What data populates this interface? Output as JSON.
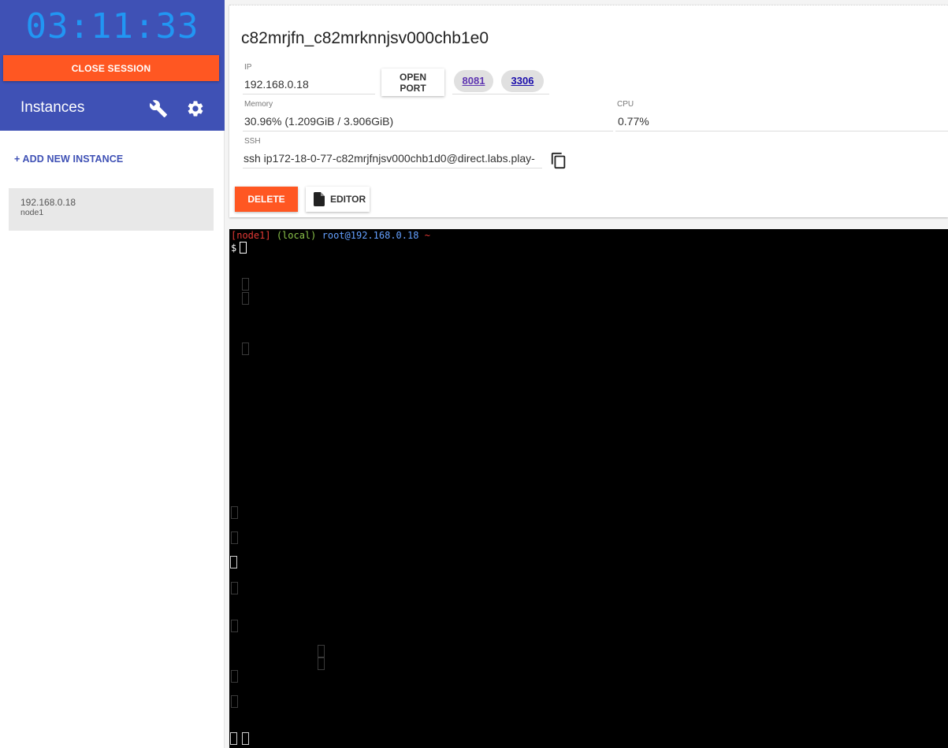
{
  "session": {
    "timer": "03:11:33",
    "close_label": "CLOSE SESSION"
  },
  "sidebar": {
    "title": "Instances",
    "add_instance_label": "+ ADD NEW INSTANCE",
    "instances": [
      {
        "ip": "192.168.0.18",
        "name": "node1"
      }
    ]
  },
  "instance": {
    "title": "c82mrjfn_c82mrknnjsv000chb1e0",
    "ip_label": "IP",
    "ip_value": "192.168.0.18",
    "open_port_label": "OPEN PORT",
    "ports": [
      "8081",
      "3306"
    ],
    "memory_label": "Memory",
    "memory_value": "30.96% (1.209GiB / 3.906GiB)",
    "cpu_label": "CPU",
    "cpu_value": "0.77%",
    "ssh_label": "SSH",
    "ssh_value": "ssh ip172-18-0-77-c82mrjfnjsv000chb1d0@direct.labs.play-",
    "delete_label": "DELETE",
    "editor_label": "EDITOR"
  },
  "terminal": {
    "prompt_node": "[node1]",
    "prompt_env": "(local)",
    "prompt_user": "root@192.168.0.18",
    "prompt_tilde": "~",
    "prompt_symbol": "$"
  },
  "colors": {
    "header_bg": "#3f51b5",
    "timer": "#2196f3",
    "accent": "#ff5722",
    "port_8081": "#5e35b1",
    "port_3306": "#1a0dab"
  },
  "icons": {
    "settings_wrench": "wrench-icon",
    "settings_gear": "gear-icon",
    "copy": "copy-icon",
    "file": "file-icon"
  }
}
